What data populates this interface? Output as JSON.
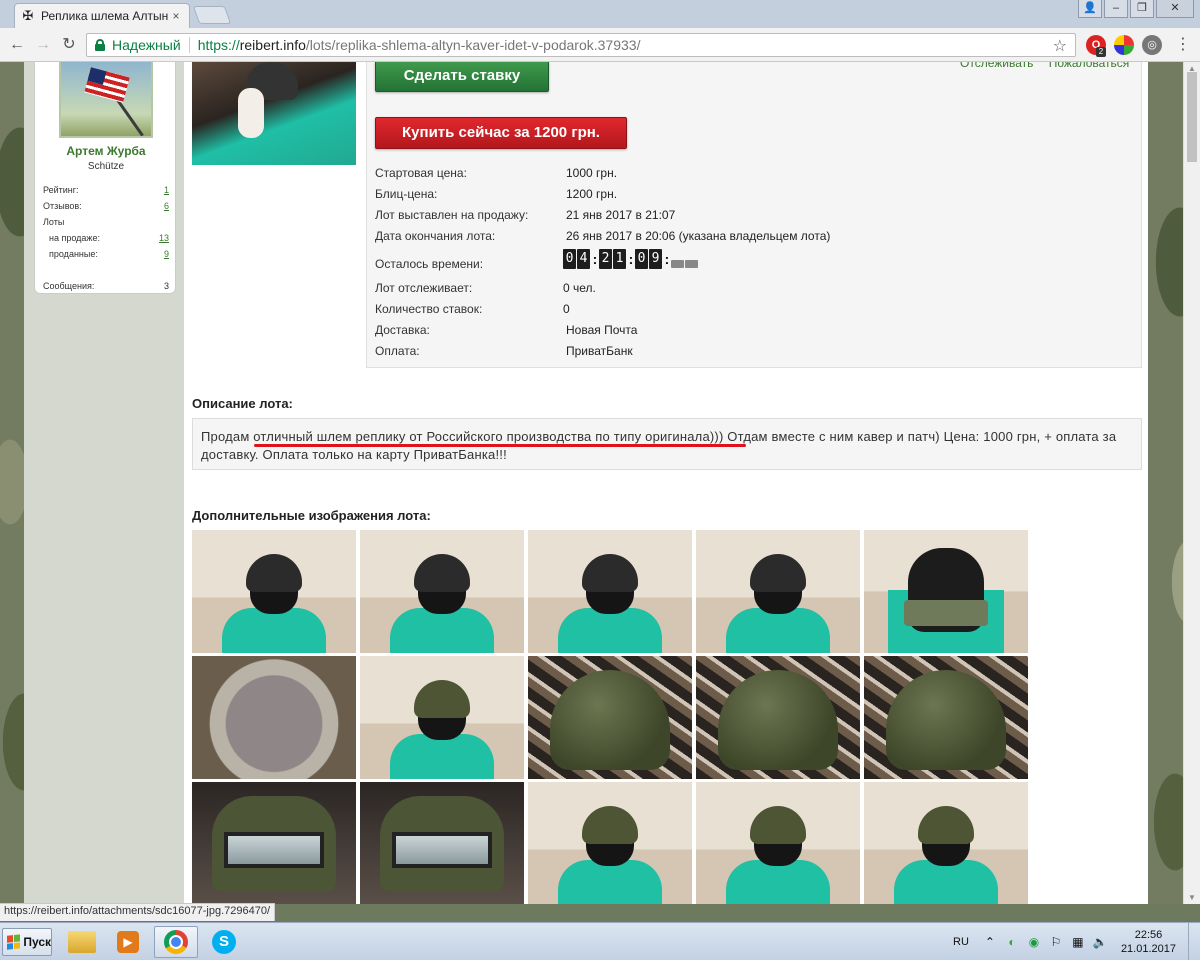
{
  "browser": {
    "tab_title": "Реплика шлема Алтын!!",
    "tab_close": "×",
    "address": {
      "secure_label": "Надежный",
      "url_proto": "https://",
      "url_host": "reibert.info",
      "url_path": "/lots/replika-shlema-altyn-kaver-idet-v-podarok.37933/"
    },
    "ext_badge": "2"
  },
  "seller": {
    "name": "Артем Журба",
    "rank": "Schütze",
    "stats": [
      {
        "label": "Рейтинг:",
        "value": "1",
        "link": true,
        "indent": false
      },
      {
        "label": "Отзывов:",
        "value": "6",
        "link": true,
        "indent": false
      },
      {
        "label": "Лоты",
        "value": "",
        "link": false,
        "indent": false
      },
      {
        "label": "на продаже:",
        "value": "13",
        "link": true,
        "indent": true
      },
      {
        "label": "проданные:",
        "value": "9",
        "link": true,
        "indent": true
      },
      {
        "label": "",
        "value": "",
        "link": false,
        "indent": false
      },
      {
        "label": "Сообщения:",
        "value": "3",
        "link": false,
        "indent": false
      }
    ]
  },
  "lot": {
    "bid_button": "Сделать ставку",
    "buy_button": "Купить сейчас за 1200 грн.",
    "watch_link": "Отслеживать",
    "report_link": "Пожаловаться",
    "fields": [
      {
        "label": "Стартовая цена:",
        "value": "1000 грн."
      },
      {
        "label": "Блиц-цена:",
        "value": "1200 грн."
      },
      {
        "label": "Лот выставлен на продажу:",
        "value": "21 янв 2017 в 21:07"
      },
      {
        "label": "Дата окончания лота:",
        "value": "26 янв 2017 в 20:06 (указана владельцем лота)"
      },
      {
        "label": "Осталось времени:",
        "value": ""
      },
      {
        "label": "Лот отслеживает:",
        "value": "0 чел."
      },
      {
        "label": "Количество ставок:",
        "value": "0"
      },
      {
        "label": "Доставка:",
        "value": "Новая Почта"
      },
      {
        "label": "Оплата:",
        "value": "ПриватБанк"
      }
    ],
    "timer": {
      "days": "04",
      "hours": "21",
      "minutes": "09",
      "seconds": ""
    }
  },
  "description": {
    "heading": "Описание лота:",
    "text": "Продам отличный шлем реплику от Российского производства по типу оригинала))) Отдам вместе с ним кавер и патч) Цена: 1000 грн, + оплата за доставку. Оплата только на карту ПриватБанка!!!"
  },
  "gallery": {
    "heading": "Дополнительные изображения лота:",
    "images": [
      {
        "kind": "person",
        "helmet": "dark"
      },
      {
        "kind": "person",
        "helmet": "dark"
      },
      {
        "kind": "back",
        "helmet": "dark"
      },
      {
        "kind": "side",
        "helmet": "dark"
      },
      {
        "kind": "top",
        "helmet": "dark"
      },
      {
        "kind": "inside",
        "helmet": "olive"
      },
      {
        "kind": "person",
        "helmet": "olive"
      },
      {
        "kind": "shell",
        "helmet": "olive"
      },
      {
        "kind": "shell",
        "helmet": "olive"
      },
      {
        "kind": "shell",
        "helmet": "olive"
      },
      {
        "kind": "visor",
        "helmet": "olive"
      },
      {
        "kind": "visor",
        "helmet": "olive"
      },
      {
        "kind": "person",
        "helmet": "olive"
      },
      {
        "kind": "person",
        "helmet": "olive"
      },
      {
        "kind": "person",
        "helmet": "olive"
      }
    ]
  },
  "status_url": "https://reibert.info/attachments/sdc16077-jpg.7296470/",
  "taskbar": {
    "start_label": "Пуск",
    "lang": "RU",
    "time": "22:56",
    "date": "21.01.2017"
  },
  "colors": {
    "green_link": "#3b7a2e",
    "bid_green": "#247236",
    "buy_red": "#b3171c",
    "underline_red": "#e0121b",
    "secure_green": "#0b8043"
  }
}
